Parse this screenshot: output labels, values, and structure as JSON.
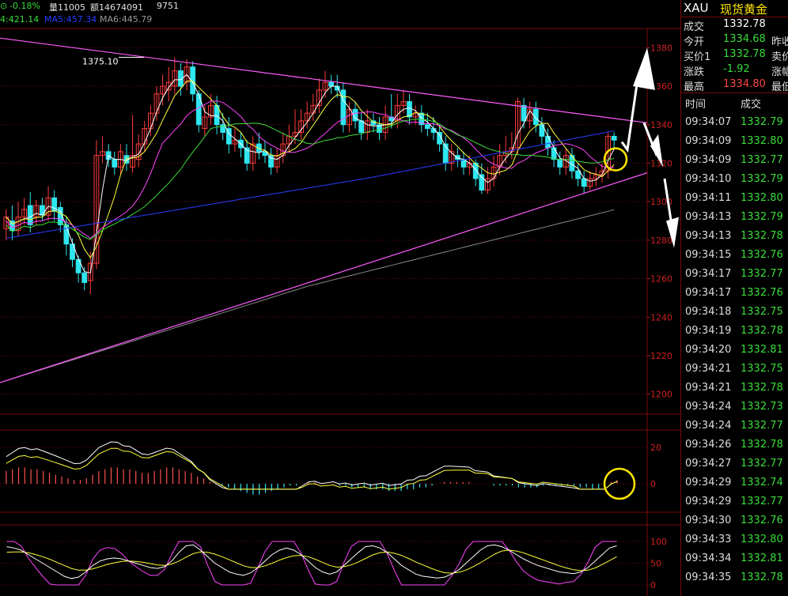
{
  "header": {
    "change_pct": "-0.18%",
    "volume": "量11005",
    "amount": "额14674091",
    "extra": "9751"
  },
  "ma_legend": {
    "ma_a": "4:421.14",
    "ma5": "MA5:457.34",
    "ma6": "MA6:445.79"
  },
  "colors": {
    "up": "#ff3b3b",
    "down": "#2ee6f0",
    "upper_trendline": "#ff5cff",
    "lower_trendline": "#ff5cff",
    "ma_white": "#ffffff",
    "ma_yellow": "#ffff3a",
    "ma_magenta": "#ff44ff",
    "ma_green": "#3adc3a",
    "ma_blue": "#2a3cff",
    "ma_gray": "#8a8a8a",
    "annotation_circle": "#ffe600",
    "annotation_arrow": "#ffffff",
    "grid": "#7a0a0a"
  },
  "price_axis": [
    "1380",
    "1360",
    "1340",
    "1320",
    "1300",
    "1280",
    "1260",
    "1240",
    "1220",
    "1200"
  ],
  "macd_axis": [
    "20",
    "0"
  ],
  "kdj_axis": [
    "100",
    "50",
    "0"
  ],
  "annotations": {
    "high_label": "1375.10"
  },
  "chart_data": {
    "type": "candlestick",
    "title": "",
    "ylim": [
      1190,
      1390
    ],
    "candles": [
      [
        1286,
        1292,
        1280,
        1296
      ],
      [
        1290,
        1285,
        1280,
        1298
      ],
      [
        1285,
        1292,
        1282,
        1300
      ],
      [
        1292,
        1296,
        1288,
        1302
      ],
      [
        1298,
        1288,
        1284,
        1305
      ],
      [
        1292,
        1298,
        1288,
        1301
      ],
      [
        1298,
        1293,
        1290,
        1302
      ],
      [
        1293,
        1302,
        1290,
        1308
      ],
      [
        1302,
        1295,
        1290,
        1306
      ],
      [
        1297,
        1288,
        1284,
        1300
      ],
      [
        1288,
        1278,
        1272,
        1292
      ],
      [
        1278,
        1270,
        1266,
        1281
      ],
      [
        1270,
        1263,
        1258,
        1272
      ],
      [
        1263,
        1258,
        1254,
        1266
      ],
      [
        1259,
        1268,
        1252,
        1274
      ],
      [
        1268,
        1324,
        1265,
        1332
      ],
      [
        1324,
        1326,
        1320,
        1334
      ],
      [
        1326,
        1322,
        1318,
        1330
      ],
      [
        1322,
        1318,
        1314,
        1326
      ],
      [
        1318,
        1326,
        1314,
        1330
      ],
      [
        1324,
        1320,
        1316,
        1330
      ],
      [
        1318,
        1324,
        1315,
        1345
      ],
      [
        1322,
        1330,
        1318,
        1335
      ],
      [
        1330,
        1338,
        1326,
        1342
      ],
      [
        1338,
        1346,
        1334,
        1350
      ],
      [
        1346,
        1356,
        1342,
        1360
      ],
      [
        1356,
        1360,
        1350,
        1366
      ],
      [
        1358,
        1362,
        1352,
        1370
      ],
      [
        1360,
        1368,
        1356,
        1375
      ],
      [
        1368,
        1360,
        1355,
        1372
      ],
      [
        1362,
        1370,
        1358,
        1374
      ],
      [
        1370,
        1356,
        1352,
        1373
      ],
      [
        1356,
        1340,
        1336,
        1358
      ],
      [
        1338,
        1344,
        1334,
        1350
      ],
      [
        1344,
        1350,
        1340,
        1356
      ],
      [
        1350,
        1340,
        1335,
        1355
      ],
      [
        1340,
        1336,
        1332,
        1346
      ],
      [
        1338,
        1330,
        1325,
        1344
      ],
      [
        1330,
        1332,
        1326,
        1338
      ],
      [
        1332,
        1328,
        1323,
        1336
      ],
      [
        1328,
        1320,
        1316,
        1332
      ],
      [
        1320,
        1330,
        1316,
        1334
      ],
      [
        1330,
        1326,
        1322,
        1336
      ],
      [
        1326,
        1324,
        1320,
        1332
      ],
      [
        1324,
        1318,
        1314,
        1328
      ],
      [
        1318,
        1324,
        1315,
        1328
      ],
      [
        1324,
        1330,
        1320,
        1336
      ],
      [
        1330,
        1334,
        1326,
        1340
      ],
      [
        1334,
        1336,
        1330,
        1348
      ],
      [
        1336,
        1342,
        1332,
        1348
      ],
      [
        1342,
        1346,
        1338,
        1352
      ],
      [
        1346,
        1350,
        1342,
        1356
      ],
      [
        1350,
        1358,
        1346,
        1364
      ],
      [
        1358,
        1362,
        1354,
        1368
      ],
      [
        1362,
        1360,
        1356,
        1366
      ],
      [
        1360,
        1358,
        1354,
        1366
      ],
      [
        1358,
        1340,
        1336,
        1362
      ],
      [
        1340,
        1348,
        1336,
        1352
      ],
      [
        1348,
        1342,
        1338,
        1352
      ],
      [
        1342,
        1336,
        1332,
        1346
      ],
      [
        1336,
        1342,
        1332,
        1348
      ],
      [
        1342,
        1340,
        1336,
        1346
      ],
      [
        1340,
        1336,
        1332,
        1344
      ],
      [
        1336,
        1344,
        1332,
        1350
      ],
      [
        1344,
        1342,
        1338,
        1356
      ],
      [
        1342,
        1350,
        1338,
        1356
      ],
      [
        1350,
        1352,
        1346,
        1358
      ],
      [
        1352,
        1344,
        1340,
        1356
      ],
      [
        1344,
        1346,
        1340,
        1350
      ],
      [
        1346,
        1340,
        1336,
        1350
      ],
      [
        1340,
        1338,
        1334,
        1346
      ],
      [
        1338,
        1336,
        1332,
        1344
      ],
      [
        1336,
        1330,
        1326,
        1340
      ],
      [
        1330,
        1320,
        1316,
        1334
      ],
      [
        1320,
        1326,
        1316,
        1330
      ],
      [
        1324,
        1322,
        1318,
        1328
      ],
      [
        1322,
        1318,
        1314,
        1326
      ],
      [
        1318,
        1320,
        1314,
        1324
      ],
      [
        1320,
        1312,
        1308,
        1322
      ],
      [
        1314,
        1306,
        1304,
        1320
      ],
      [
        1306,
        1312,
        1304,
        1318
      ],
      [
        1312,
        1318,
        1308,
        1324
      ],
      [
        1318,
        1324,
        1314,
        1330
      ],
      [
        1324,
        1326,
        1320,
        1334
      ],
      [
        1326,
        1328,
        1322,
        1336
      ],
      [
        1328,
        1352,
        1324,
        1354
      ],
      [
        1350,
        1342,
        1338,
        1354
      ],
      [
        1342,
        1348,
        1338,
        1352
      ],
      [
        1348,
        1340,
        1336,
        1352
      ],
      [
        1340,
        1334,
        1330,
        1344
      ],
      [
        1334,
        1328,
        1324,
        1338
      ],
      [
        1328,
        1322,
        1318,
        1332
      ],
      [
        1322,
        1318,
        1314,
        1326
      ],
      [
        1318,
        1324,
        1314,
        1328
      ],
      [
        1324,
        1316,
        1312,
        1328
      ],
      [
        1316,
        1312,
        1308,
        1320
      ],
      [
        1312,
        1308,
        1304,
        1316
      ],
      [
        1308,
        1312,
        1306,
        1316
      ],
      [
        1312,
        1314,
        1308,
        1318
      ],
      [
        1314,
        1316,
        1310,
        1320
      ],
      [
        1316,
        1334,
        1312,
        1336
      ],
      [
        1334,
        1332,
        1328,
        1336
      ]
    ],
    "macd_bars": [
      7,
      8,
      9,
      9,
      8,
      8,
      7,
      6,
      5,
      4,
      3,
      2,
      2,
      3,
      5,
      7,
      8,
      9,
      9,
      8,
      8,
      7,
      6,
      6,
      7,
      8,
      9,
      9,
      8,
      7,
      6,
      4,
      3,
      1,
      0,
      -1,
      -2,
      -3,
      -4,
      -5,
      -6,
      -6,
      -5,
      -4,
      -3,
      -2,
      -1,
      -1,
      0,
      1,
      1,
      0,
      0,
      0,
      -1,
      -1,
      -2,
      -2,
      -2,
      -3,
      -3,
      -3,
      -4,
      -4,
      -4,
      -3,
      -3,
      -2,
      -2,
      -1,
      0,
      1,
      1,
      1,
      1,
      1,
      0,
      0,
      0,
      -1,
      -1,
      -1,
      -1,
      -2,
      -2,
      -2,
      -2,
      -1,
      -1,
      -1,
      -1,
      -1,
      -1,
      -2,
      -2,
      -3,
      -3,
      -2,
      1,
      2
    ],
    "kdj_k": [
      88,
      85,
      80,
      70,
      60,
      50,
      40,
      30,
      20,
      15,
      18,
      30,
      45,
      55,
      60,
      62,
      60,
      55,
      50,
      45,
      40,
      38,
      42,
      55,
      75,
      90,
      92,
      80,
      65,
      50,
      40,
      30,
      25,
      22,
      28,
      40,
      55,
      70,
      80,
      85,
      80,
      70,
      55,
      40,
      30,
      25,
      30,
      45,
      60,
      75,
      88,
      90,
      85,
      75,
      60,
      45,
      35,
      25,
      20,
      18,
      16,
      18,
      25,
      35,
      50,
      65,
      80,
      90,
      92,
      88,
      80,
      70,
      60,
      52,
      45,
      40,
      35,
      30,
      28,
      26,
      30,
      40,
      55,
      70,
      85,
      90
    ],
    "kdj_d": [
      75,
      76,
      76,
      74,
      70,
      65,
      59,
      52,
      45,
      38,
      34,
      34,
      37,
      42,
      47,
      51,
      54,
      55,
      54,
      52,
      49,
      46,
      45,
      48,
      55,
      64,
      72,
      76,
      75,
      71,
      65,
      58,
      51,
      44,
      40,
      40,
      44,
      50,
      57,
      63,
      67,
      68,
      65,
      59,
      52,
      45,
      41,
      42,
      46,
      53,
      61,
      69,
      74,
      76,
      73,
      68,
      61,
      53,
      46,
      39,
      33,
      28,
      27,
      29,
      34,
      42,
      51,
      61,
      71,
      78,
      80,
      78,
      74,
      68,
      62,
      56,
      50,
      44,
      39,
      35,
      33,
      34,
      39,
      47,
      56,
      65
    ],
    "kdj_j": [
      100,
      100,
      90,
      62,
      40,
      20,
      2,
      0,
      0,
      0,
      0,
      22,
      60,
      80,
      86,
      84,
      72,
      55,
      42,
      31,
      22,
      22,
      36,
      70,
      100,
      100,
      100,
      88,
      45,
      8,
      0,
      0,
      0,
      0,
      4,
      40,
      77,
      100,
      100,
      100,
      100,
      74,
      35,
      2,
      0,
      0,
      8,
      52,
      88,
      100,
      100,
      100,
      100,
      73,
      34,
      0,
      0,
      0,
      0,
      0,
      0,
      0,
      21,
      47,
      82,
      100,
      100,
      100,
      100,
      100,
      80,
      54,
      32,
      20,
      11,
      8,
      5,
      2,
      6,
      8,
      24,
      52,
      87,
      100,
      100,
      100
    ]
  },
  "quote": {
    "symbol": "XAU",
    "name": "现货黄金",
    "rows": [
      {
        "label": "成交",
        "value": "1332.78",
        "label2": "",
        "color": "#ffffff"
      },
      {
        "label": "今开",
        "value": "1334.68",
        "label2": "昨收",
        "color": "#3adc3a"
      },
      {
        "label": "买价1",
        "value": "1332.78",
        "label2": "卖价",
        "color": "#3adc3a"
      },
      {
        "label": "涨跌",
        "value": "-1.92",
        "label2": "涨幅",
        "color": "#3adc3a"
      },
      {
        "label": "最高",
        "value": "1334.80",
        "label2": "最低",
        "color": "#ff4444"
      }
    ]
  },
  "ticks": {
    "header_time": "时间",
    "header_price": "成交",
    "rows": [
      {
        "time": "09:34:07",
        "price": "1332.79",
        "color": "#3adc3a"
      },
      {
        "time": "09:34:09",
        "price": "1332.80",
        "color": "#3adc3a"
      },
      {
        "time": "09:34:09",
        "price": "1332.77",
        "color": "#3adc3a"
      },
      {
        "time": "09:34:10",
        "price": "1332.79",
        "color": "#3adc3a"
      },
      {
        "time": "09:34:11",
        "price": "1332.80",
        "color": "#3adc3a"
      },
      {
        "time": "09:34:13",
        "price": "1332.79",
        "color": "#3adc3a"
      },
      {
        "time": "09:34:13",
        "price": "1332.78",
        "color": "#3adc3a"
      },
      {
        "time": "09:34:15",
        "price": "1332.76",
        "color": "#3adc3a"
      },
      {
        "time": "09:34:17",
        "price": "1332.77",
        "color": "#3adc3a"
      },
      {
        "time": "09:34:17",
        "price": "1332.76",
        "color": "#3adc3a"
      },
      {
        "time": "09:34:18",
        "price": "1332.75",
        "color": "#3adc3a"
      },
      {
        "time": "09:34:19",
        "price": "1332.78",
        "color": "#3adc3a"
      },
      {
        "time": "09:34:20",
        "price": "1332.81",
        "color": "#3adc3a"
      },
      {
        "time": "09:34:21",
        "price": "1332.75",
        "color": "#3adc3a"
      },
      {
        "time": "09:34:21",
        "price": "1332.78",
        "color": "#3adc3a"
      },
      {
        "time": "09:34:24",
        "price": "1332.73",
        "color": "#3adc3a"
      },
      {
        "time": "09:34:24",
        "price": "1332.77",
        "color": "#3adc3a"
      },
      {
        "time": "09:34:26",
        "price": "1332.78",
        "color": "#3adc3a"
      },
      {
        "time": "09:34:27",
        "price": "1332.77",
        "color": "#3adc3a"
      },
      {
        "time": "09:34:29",
        "price": "1332.74",
        "color": "#3adc3a"
      },
      {
        "time": "09:34:29",
        "price": "1332.77",
        "color": "#3adc3a"
      },
      {
        "time": "09:34:30",
        "price": "1332.76",
        "color": "#3adc3a"
      },
      {
        "time": "09:34:33",
        "price": "1332.80",
        "color": "#3adc3a"
      },
      {
        "time": "09:34:34",
        "price": "1332.81",
        "color": "#3adc3a"
      },
      {
        "time": "09:34:35",
        "price": "1332.78",
        "color": "#3adc3a"
      }
    ]
  }
}
